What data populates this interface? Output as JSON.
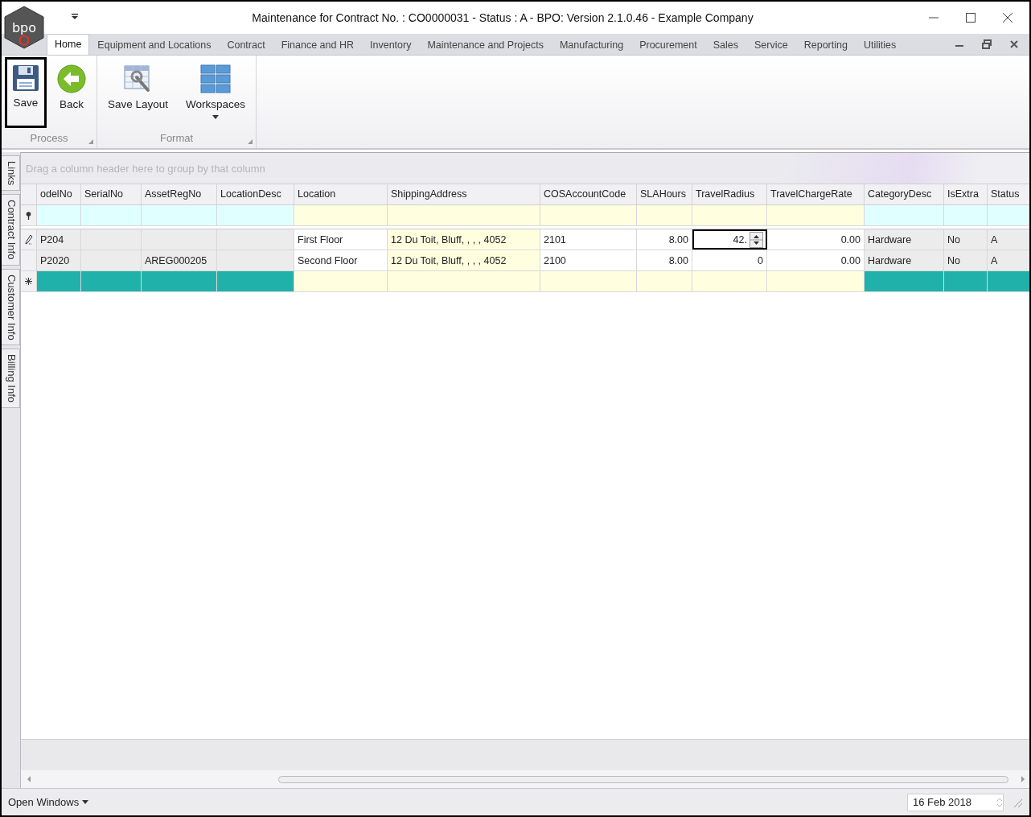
{
  "window": {
    "title": "Maintenance for Contract No. : CO0000031 - Status : A - BPO: Version 2.1.0.46 - Example Company"
  },
  "logo": {
    "text": "bpo"
  },
  "tabs": [
    {
      "label": "Home",
      "selected": true
    },
    {
      "label": "Equipment and Locations",
      "selected": false
    },
    {
      "label": "Contract",
      "selected": false
    },
    {
      "label": "Finance and HR",
      "selected": false
    },
    {
      "label": "Inventory",
      "selected": false
    },
    {
      "label": "Maintenance and Projects",
      "selected": false
    },
    {
      "label": "Manufacturing",
      "selected": false
    },
    {
      "label": "Procurement",
      "selected": false
    },
    {
      "label": "Sales",
      "selected": false
    },
    {
      "label": "Service",
      "selected": false
    },
    {
      "label": "Reporting",
      "selected": false
    },
    {
      "label": "Utilities",
      "selected": false
    }
  ],
  "ribbon_groups": [
    {
      "label": "Process",
      "buttons": [
        {
          "label": "Save",
          "kind": "save",
          "selected": true
        },
        {
          "label": "Back",
          "kind": "back",
          "selected": false
        }
      ]
    },
    {
      "label": "Format",
      "buttons": [
        {
          "label": "Save Layout",
          "kind": "layout",
          "selected": false
        },
        {
          "label": "Workspaces",
          "kind": "workspaces",
          "selected": false
        }
      ]
    }
  ],
  "side_tabs": [
    "Links",
    "Contract Info",
    "Customer Info",
    "Billing Info"
  ],
  "group_panel": {
    "placeholder": "Drag a column header here to group by that column"
  },
  "columns": [
    {
      "label": "odelNo",
      "editable": false,
      "kind": "text"
    },
    {
      "label": "SerialNo",
      "editable": false,
      "kind": "text"
    },
    {
      "label": "AssetRegNo",
      "editable": false,
      "kind": "text"
    },
    {
      "label": "LocationDesc",
      "editable": false,
      "kind": "text"
    },
    {
      "label": "Location",
      "editable": true,
      "kind": "text"
    },
    {
      "label": "ShippingAddress",
      "editable": true,
      "kind": "text"
    },
    {
      "label": "COSAccountCode",
      "editable": true,
      "kind": "text"
    },
    {
      "label": "SLAHours",
      "editable": true,
      "kind": "number"
    },
    {
      "label": "TravelRadius",
      "editable": true,
      "kind": "number"
    },
    {
      "label": "TravelChargeRate",
      "editable": true,
      "kind": "number"
    },
    {
      "label": "CategoryDesc",
      "editable": false,
      "kind": "text"
    },
    {
      "label": "IsExtra",
      "editable": false,
      "kind": "text"
    },
    {
      "label": "Status",
      "editable": false,
      "kind": "text"
    }
  ],
  "rows": [
    {
      "editing": true,
      "cells": [
        {
          "text": "P204",
          "focused": false
        },
        {
          "focused": false
        },
        {
          "focused": false
        },
        {
          "focused": false
        },
        {
          "text": "First Floor",
          "focused": false
        },
        {
          "text": "12 Du Toit, Bluff, , , , 4052",
          "focused": false
        },
        {
          "text": "2101",
          "focused": false
        },
        {
          "text": "8.00",
          "focused": false
        },
        {
          "text": "42.",
          "focused": true
        },
        {
          "text": "0.00",
          "focused": false
        },
        {
          "text": "Hardware",
          "focused": false
        },
        {
          "text": "No",
          "focused": false
        },
        {
          "text": "A",
          "focused": false
        }
      ]
    },
    {
      "editing": false,
      "cells": [
        {
          "text": "P2020",
          "focused": false
        },
        {
          "focused": false
        },
        {
          "text": "AREG000205",
          "focused": false
        },
        {
          "focused": false
        },
        {
          "text": "Second Floor",
          "focused": false
        },
        {
          "text": "12 Du Toit, Bluff, , , , 4052",
          "focused": false
        },
        {
          "text": "2100",
          "focused": false
        },
        {
          "text": "8.00",
          "focused": false
        },
        {
          "text": "0",
          "focused": false
        },
        {
          "text": "0.00",
          "focused": false
        },
        {
          "text": "Hardware",
          "focused": false
        },
        {
          "text": "No",
          "focused": false
        },
        {
          "text": "A",
          "focused": false
        }
      ]
    }
  ],
  "status_bar": {
    "menu": "Open Windows",
    "date": "16 Feb 2018"
  }
}
